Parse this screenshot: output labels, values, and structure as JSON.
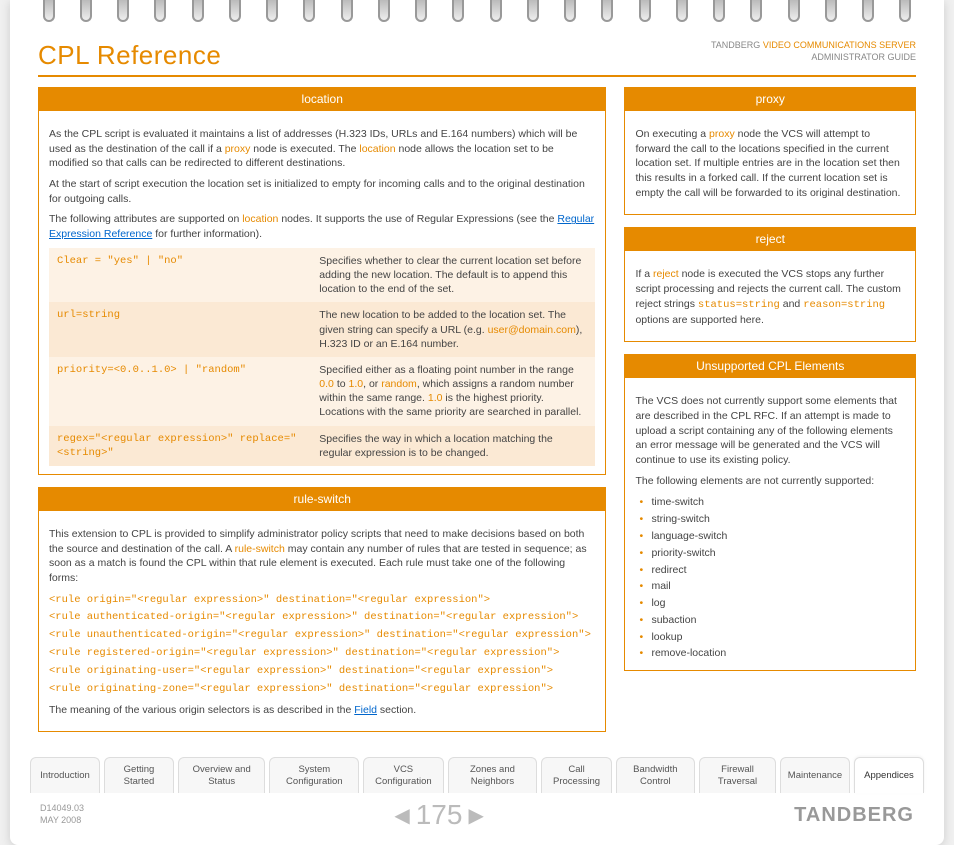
{
  "header": {
    "title": "CPL Reference",
    "product_line1_prefix": "TANDBERG ",
    "product_line1_orange": "VIDEO COMMUNICATIONS SERVER",
    "product_line2": "ADMINISTRATOR GUIDE"
  },
  "location": {
    "title": "location",
    "para1_a": "As the CPL script is evaluated it maintains a list of addresses (H.323 IDs, URLs and E.164 numbers) which will be used as the destination of the call if a ",
    "para1_proxy": "proxy",
    "para1_b": " node is executed. The ",
    "para1_location": "location",
    "para1_c": " node allows the location set to be modified so that calls can be redirected to different destinations.",
    "para2": "At the start of script execution the location set is initialized to empty for incoming calls and to the original destination for outgoing calls.",
    "para3_a": "The following attributes are supported on ",
    "para3_location": "location",
    "para3_b": " nodes. It supports the use of Regular Expressions (see the ",
    "para3_link": "Regular Expression Reference",
    "para3_c": " for further information).",
    "attrs": [
      {
        "syn": "Clear = \"yes\" | \"no\"",
        "desc": "Specifies whether to clear the current location set before adding the new location. The default is to append this location to the end of the set."
      },
      {
        "syn": "url=string",
        "desc_a": "The new location to be added to the location set. The given string can specify a URL (e.g. ",
        "desc_kw": "user@domain.com",
        "desc_b": "), H.323 ID or an E.164 number."
      },
      {
        "syn": "priority=<0.0..1.0> | \"random\"",
        "desc_a": "Specified either as a floating point number in the range ",
        "desc_kw1": "0.0",
        "desc_b": " to ",
        "desc_kw2": "1.0",
        "desc_c": ", or ",
        "desc_kw3": "random",
        "desc_d": ", which assigns a random number within the same range.  ",
        "desc_kw4": "1.0",
        "desc_e": " is the highest priority.  Locations with the same priority are searched in parallel."
      },
      {
        "syn": "regex=\"<regular expression>\" replace=\"<string>\"",
        "desc": "Specifies the way in which a location matching the regular expression is to be changed."
      }
    ]
  },
  "ruleswitch": {
    "title": "rule-switch",
    "para_a": "This extension to CPL is provided to simplify administrator policy scripts that need to make decisions based on both the source and destination of the call. A ",
    "para_kw": "rule-switch",
    "para_b": " may contain any number of rules that are tested in sequence; as soon as a match is found the CPL within that rule element is executed. Each rule must take one of the following forms:",
    "rules": [
      "<rule origin=\"<regular expression>\" destination=\"<regular expression\">",
      "<rule authenticated-origin=\"<regular expression>\" destination=\"<regular expression\">",
      "<rule unauthenticated-origin=\"<regular expression>\" destination=\"<regular expression\">",
      "<rule registered-origin=\"<regular expression>\" destination=\"<regular expression\">",
      "<rule originating-user=\"<regular expression>\" destination=\"<regular expression\">",
      "<rule originating-zone=\"<regular expression>\" destination=\"<regular expression\">"
    ],
    "foot_a": "The meaning of the various origin selectors is as described in the ",
    "foot_link": "Field",
    "foot_b": " section."
  },
  "proxy": {
    "title": "proxy",
    "para_a": "On executing a ",
    "para_kw": "proxy",
    "para_b": " node the VCS will attempt to forward the call to the locations specified in the current location set. If multiple entries are in the location set then this results in a forked call. If the current location set is empty the call will be forwarded to its original destination."
  },
  "reject": {
    "title": "reject",
    "para_a": "If a ",
    "para_kw1": "reject",
    "para_b": " node is executed the VCS stops any further script processing and rejects the current call. The custom reject strings ",
    "para_kw2": "status=string",
    "para_c": " and ",
    "para_kw3": "reason=string",
    "para_d": " options are supported here."
  },
  "unsupported": {
    "title": "Unsupported CPL Elements",
    "para1": "The VCS does not currently support some elements that are described in the CPL RFC. If an attempt is made to upload a script containing any of the following elements an error message will be generated and the VCS will continue to use its existing policy.",
    "para2": "The following elements are not currently supported:",
    "items": [
      "time-switch",
      "string-switch",
      "language-switch",
      "priority-switch",
      "redirect",
      "mail",
      "log",
      "subaction",
      "lookup",
      "remove-location"
    ]
  },
  "tabs": [
    "Introduction",
    "Getting Started",
    "Overview and Status",
    "System Configuration",
    "VCS Configuration",
    "Zones and Neighbors",
    "Call Processing",
    "Bandwidth Control",
    "Firewall Traversal",
    "Maintenance",
    "Appendices"
  ],
  "active_tab": 10,
  "footer": {
    "doc_id": "D14049.03",
    "doc_date": "MAY 2008",
    "page_num": "175",
    "brand": "TANDBERG"
  }
}
